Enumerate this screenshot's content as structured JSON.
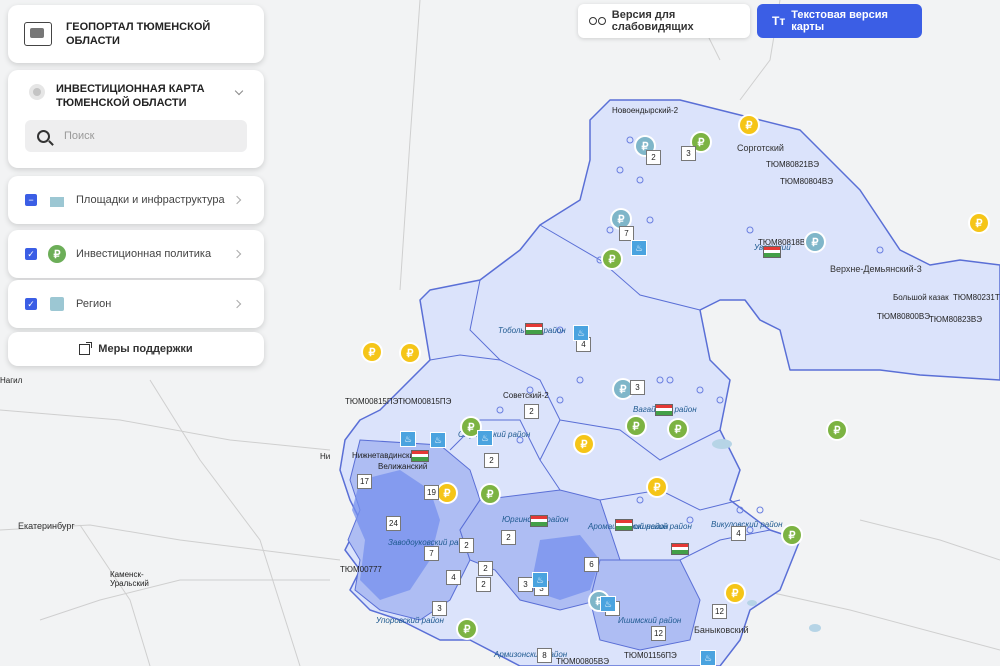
{
  "header": {
    "title": "ГЕОПОРТАЛ ТЮМЕНСКОЙ ОБЛАСТИ",
    "low_vision_button": "Версия для слабовидящих",
    "text_version_button": "Текстовая версия карты",
    "text_icon": "Tт"
  },
  "invest_panel": {
    "title": "ИНВЕСТИЦИОННАЯ КАРТА ТЮМЕНСКОЙ ОБЛАСТИ",
    "search_placeholder": "Поиск"
  },
  "layers": [
    {
      "label": "Площадки и инфраструктура",
      "checked": "partial",
      "icon": "infrastructure-icon"
    },
    {
      "label": "Инвестиционная политика",
      "checked": true,
      "icon": "ruble-icon"
    },
    {
      "label": "Регион",
      "checked": true,
      "icon": "region-icon"
    }
  ],
  "support_button": "Меры поддержки",
  "colors": {
    "accent": "#3b5ee5",
    "region_fill": "#c9d3f5",
    "region_fill_dark": "#8fa4ee",
    "marker_yellow": "#f5c518",
    "marker_green": "#7cb342",
    "marker_blue": "#7fb6c9"
  },
  "map": {
    "place_labels": [
      "Новоендырский-2",
      "Сорготский",
      "ТЮМ80821ВЭ",
      "ТЮМ80804ВЭ",
      "ТЮМ80818ВЭ",
      "Верхне-Демьянский-3",
      "Большой казак",
      "ТЮМ80231ТР",
      "ТЮМ80800ВЭ",
      "ТЮМ80823ВЭ",
      "ТЮМ00815ПЭ",
      "ТЮМ00815ПЭ",
      "Советский-2",
      "Нижнетавдинский-2",
      "Велижанский",
      "Екатеринбург",
      "Каменск-Уральский",
      "Нагил",
      "Ни",
      "ТЮМ00777",
      "Баныковский",
      "ТЮМ01156ПЭ",
      "ТЮМ00805ВЭ",
      "Уватский",
      "Тобольский район",
      "Вагайский район",
      "Юргинский район",
      "Армизонский район",
      "Викуловский район",
      "Ишимский район",
      "Упоровский район",
      "Заводоуковский район",
      "Аромашевский район",
      "Сорокинский район",
      "Омутинский район"
    ],
    "number_badges": [
      "2",
      "3",
      "7",
      "4",
      "3",
      "2",
      "2",
      "17",
      "19",
      "24",
      "2",
      "2",
      "4",
      "4",
      "6",
      "3",
      "3",
      "2",
      "12",
      "3",
      "12",
      "2",
      "8",
      "7",
      "2"
    ]
  }
}
